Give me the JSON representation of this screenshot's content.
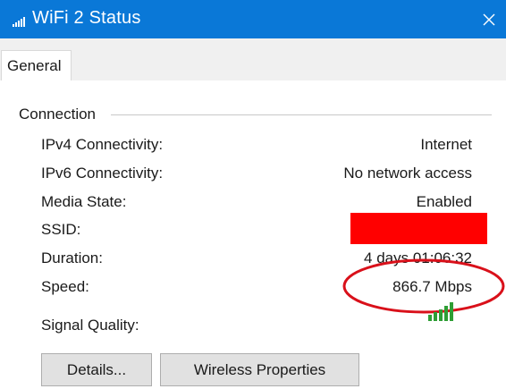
{
  "window": {
    "title": "WiFi 2 Status"
  },
  "tabs": [
    {
      "label": "General"
    }
  ],
  "connection": {
    "heading": "Connection",
    "rows": [
      {
        "label": "IPv4 Connectivity:",
        "value": "Internet"
      },
      {
        "label": "IPv6 Connectivity:",
        "value": "No network access"
      },
      {
        "label": "Media State:",
        "value": "Enabled"
      },
      {
        "label": "SSID:",
        "value": ""
      },
      {
        "label": "Duration:",
        "value": "4 days 01:06:32"
      },
      {
        "label": "Speed:",
        "value": "866.7 Mbps"
      }
    ],
    "signal": {
      "label": "Signal Quality:",
      "bars_filled": 5,
      "bars_total": 5,
      "icon": "signal-strength-icon"
    }
  },
  "buttons": {
    "details": "Details...",
    "wireless_properties": "Wireless Properties"
  },
  "colors": {
    "titlebar": "#0a78d7",
    "signal": "#2e9e35",
    "redaction": "#ff0000",
    "annotation": "#d9101a"
  }
}
